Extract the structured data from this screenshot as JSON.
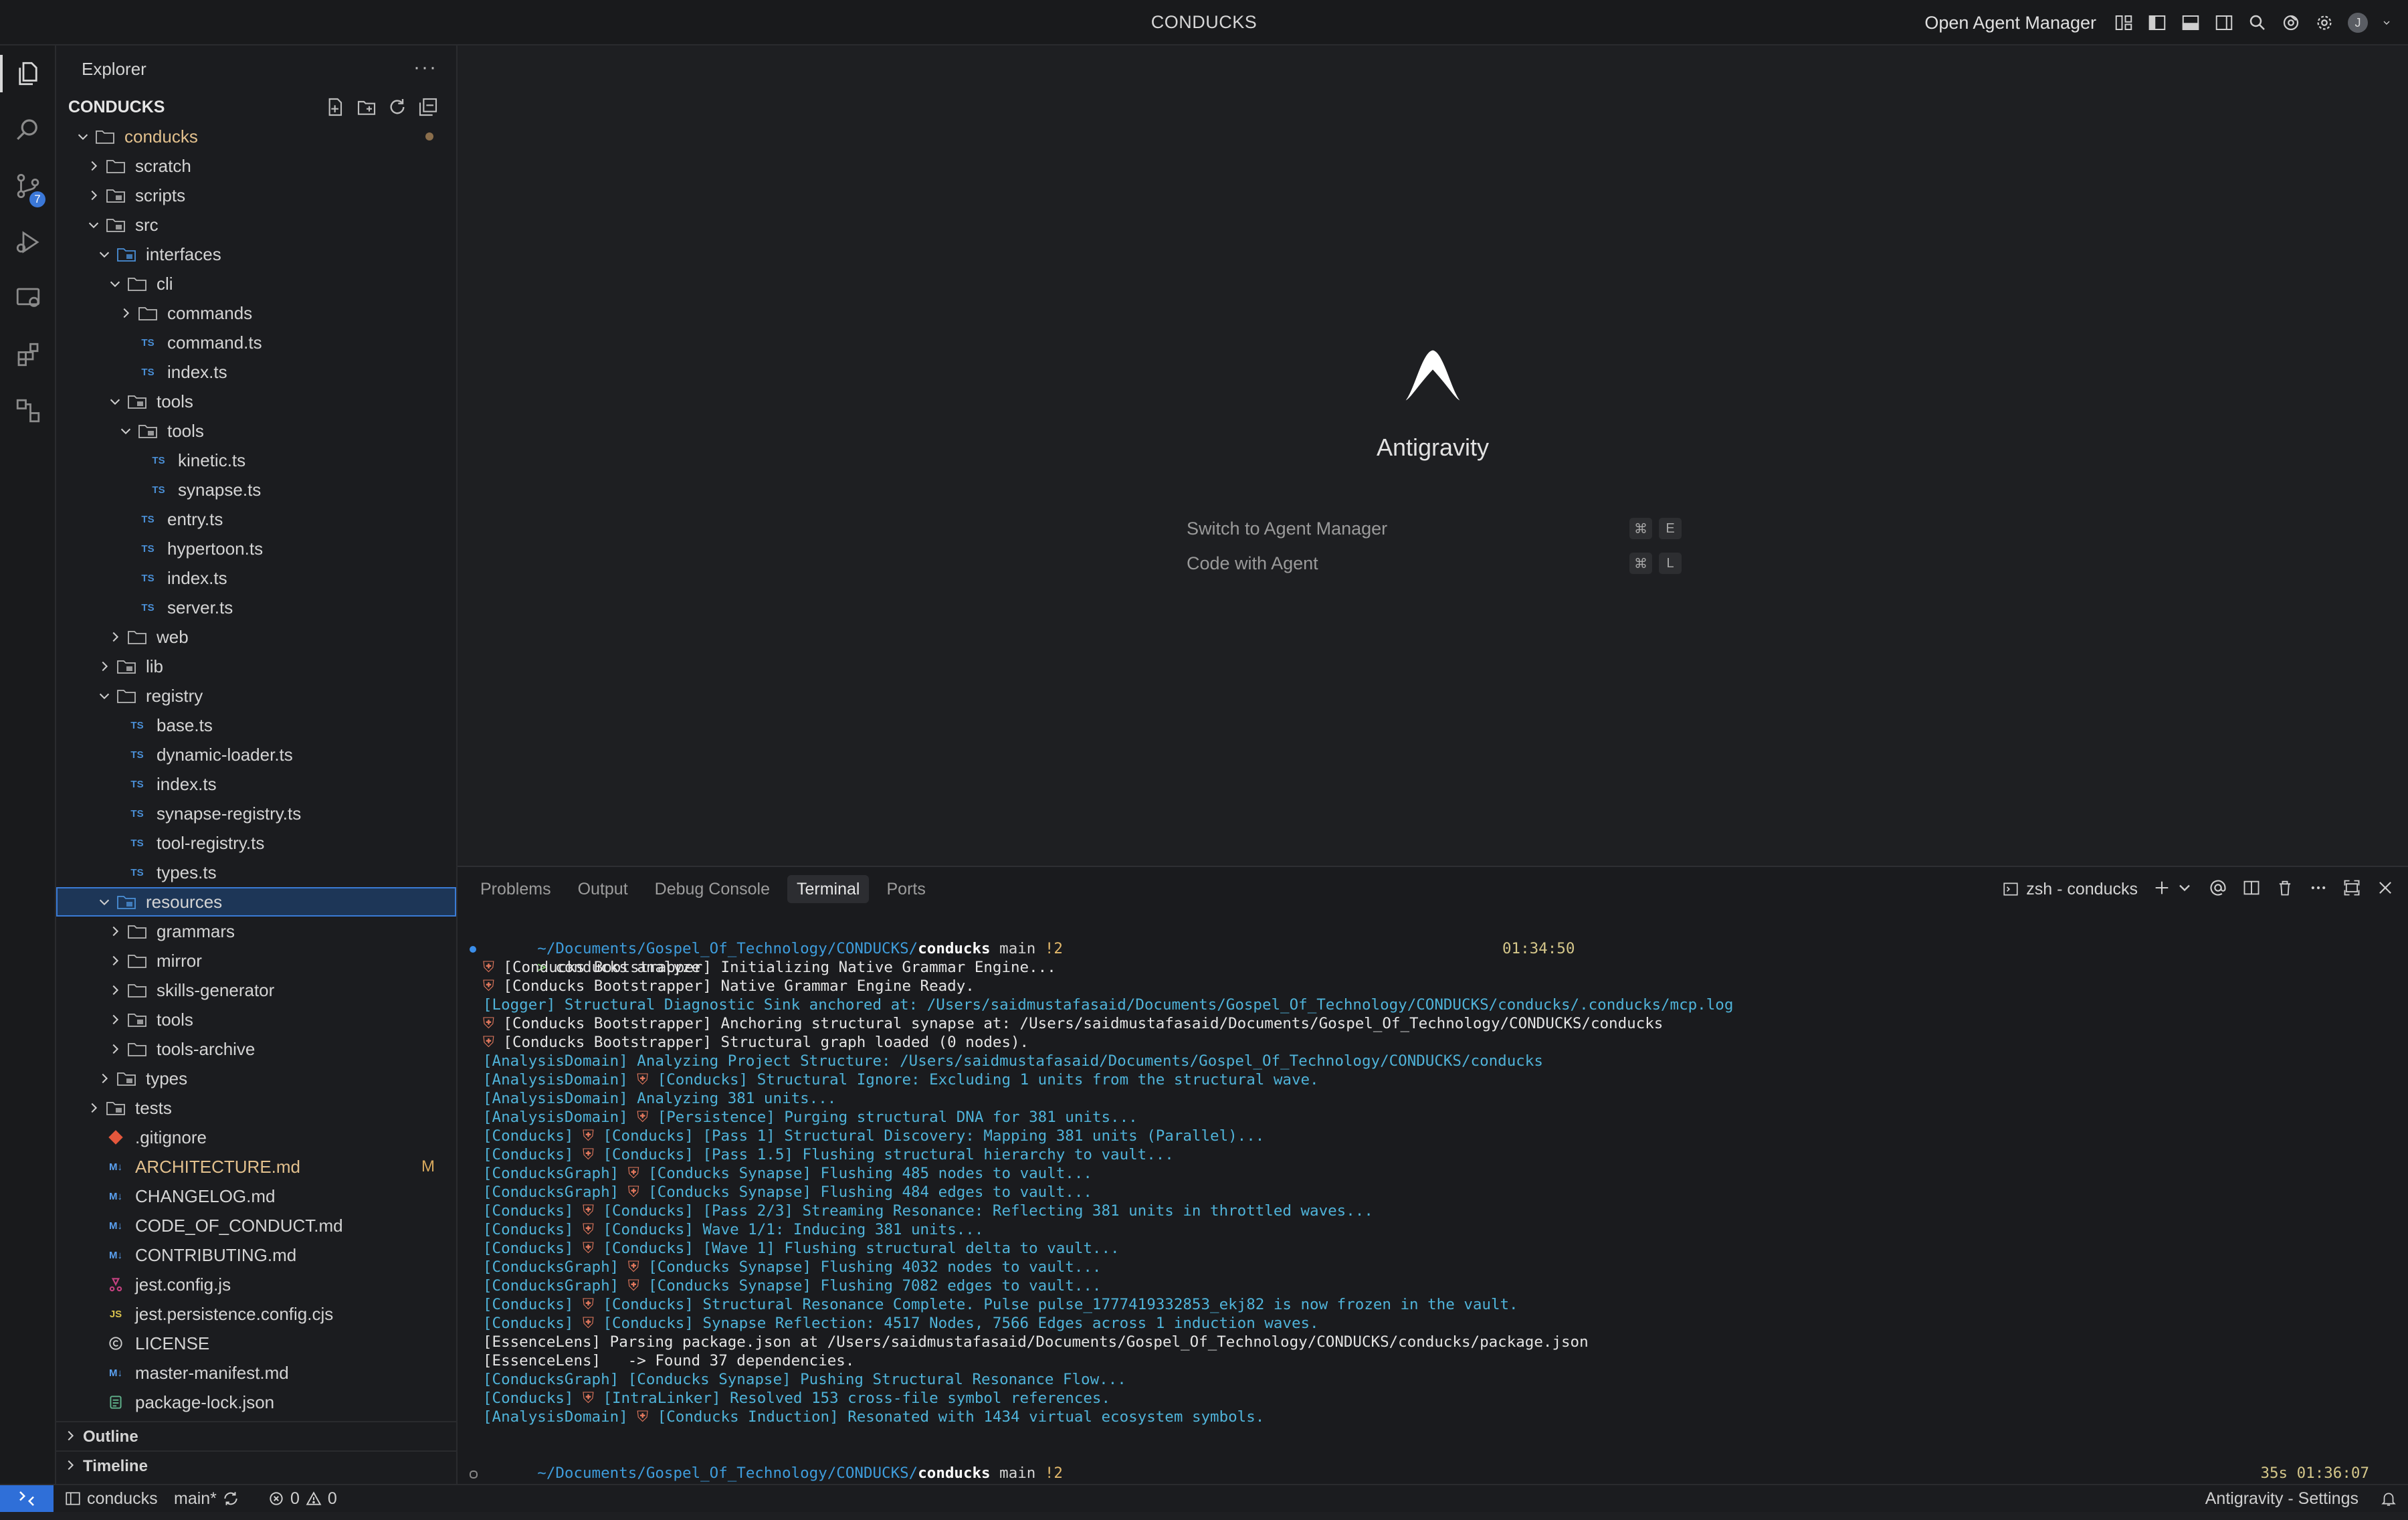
{
  "titlebar": {
    "title": "CONDUCKS",
    "agent_manager_label": "Open Agent Manager",
    "account_initial": "J"
  },
  "activity_bar": {
    "scm_badge": "7"
  },
  "sidebar": {
    "title": "Explorer",
    "more_label": "···",
    "root_label": "CONDUCKS",
    "tree": [
      {
        "label": "conducks",
        "depth": 0,
        "kind": "folder",
        "open": true,
        "gold": true,
        "dot": true
      },
      {
        "label": "scratch",
        "depth": 1,
        "kind": "folder",
        "open": false
      },
      {
        "label": "scripts",
        "depth": 1,
        "kind": "folder-special",
        "open": false
      },
      {
        "label": "src",
        "depth": 1,
        "kind": "folder-special",
        "open": true
      },
      {
        "label": "interfaces",
        "depth": 2,
        "kind": "folder-blue",
        "open": true
      },
      {
        "label": "cli",
        "depth": 3,
        "kind": "folder",
        "open": true
      },
      {
        "label": "commands",
        "depth": 4,
        "kind": "folder",
        "open": false
      },
      {
        "label": "command.ts",
        "depth": 4,
        "kind": "ts"
      },
      {
        "label": "index.ts",
        "depth": 4,
        "kind": "ts"
      },
      {
        "label": "tools",
        "depth": 3,
        "kind": "folder-special",
        "open": true
      },
      {
        "label": "tools",
        "depth": 4,
        "kind": "folder-special",
        "open": true
      },
      {
        "label": "kinetic.ts",
        "depth": 5,
        "kind": "ts"
      },
      {
        "label": "synapse.ts",
        "depth": 5,
        "kind": "ts"
      },
      {
        "label": "entry.ts",
        "depth": 4,
        "kind": "ts"
      },
      {
        "label": "hypertoon.ts",
        "depth": 4,
        "kind": "ts"
      },
      {
        "label": "index.ts",
        "depth": 4,
        "kind": "ts"
      },
      {
        "label": "server.ts",
        "depth": 4,
        "kind": "ts"
      },
      {
        "label": "web",
        "depth": 3,
        "kind": "folder",
        "open": false
      },
      {
        "label": "lib",
        "depth": 2,
        "kind": "folder-special",
        "open": false
      },
      {
        "label": "registry",
        "depth": 2,
        "kind": "folder",
        "open": true
      },
      {
        "label": "base.ts",
        "depth": 3,
        "kind": "ts"
      },
      {
        "label": "dynamic-loader.ts",
        "depth": 3,
        "kind": "ts"
      },
      {
        "label": "index.ts",
        "depth": 3,
        "kind": "ts"
      },
      {
        "label": "synapse-registry.ts",
        "depth": 3,
        "kind": "ts"
      },
      {
        "label": "tool-registry.ts",
        "depth": 3,
        "kind": "ts"
      },
      {
        "label": "types.ts",
        "depth": 3,
        "kind": "ts"
      },
      {
        "label": "resources",
        "depth": 2,
        "kind": "folder-blue",
        "open": true,
        "selected": true
      },
      {
        "label": "grammars",
        "depth": 3,
        "kind": "folder",
        "open": false
      },
      {
        "label": "mirror",
        "depth": 3,
        "kind": "folder",
        "open": false
      },
      {
        "label": "skills-generator",
        "depth": 3,
        "kind": "folder",
        "open": false
      },
      {
        "label": "tools",
        "depth": 3,
        "kind": "folder-special",
        "open": false
      },
      {
        "label": "tools-archive",
        "depth": 3,
        "kind": "folder",
        "open": false
      },
      {
        "label": "types",
        "depth": 2,
        "kind": "folder-special",
        "open": false
      },
      {
        "label": "tests",
        "depth": 1,
        "kind": "folder-special",
        "open": false
      },
      {
        "label": ".gitignore",
        "depth": 1,
        "kind": "git"
      },
      {
        "label": "ARCHITECTURE.md",
        "depth": 1,
        "kind": "md",
        "gold": true,
        "mod": "M"
      },
      {
        "label": "CHANGELOG.md",
        "depth": 1,
        "kind": "md"
      },
      {
        "label": "CODE_OF_CONDUCT.md",
        "depth": 1,
        "kind": "md"
      },
      {
        "label": "CONTRIBUTING.md",
        "depth": 1,
        "kind": "md"
      },
      {
        "label": "jest.config.js",
        "depth": 1,
        "kind": "jest"
      },
      {
        "label": "jest.persistence.config.cjs",
        "depth": 1,
        "kind": "js"
      },
      {
        "label": "LICENSE",
        "depth": 1,
        "kind": "license"
      },
      {
        "label": "master-manifest.md",
        "depth": 1,
        "kind": "md"
      },
      {
        "label": "package-lock.json",
        "depth": 1,
        "kind": "json"
      }
    ],
    "outline_label": "Outline",
    "timeline_label": "Timeline"
  },
  "editor": {
    "brand": "Antigravity",
    "shortcuts": [
      {
        "label": "Switch to Agent Manager",
        "keys": [
          "⌘",
          "E"
        ]
      },
      {
        "label": "Code with Agent",
        "keys": [
          "⌘",
          "L"
        ]
      }
    ]
  },
  "panel": {
    "tabs": [
      "Problems",
      "Output",
      "Debug Console",
      "Terminal",
      "Ports"
    ],
    "active_tab": "Terminal",
    "terminal_name": "zsh - conducks",
    "prompt1": {
      "path": "~/Documents/Gospel_Of_Technology/CONDUCKS/",
      "dir": "conducks",
      "branch": "main",
      "changes": "!2",
      "time": "01:34:50"
    },
    "command": "conducks analyze",
    "lines": [
      {
        "color": "white",
        "shield": true,
        "text": "[Conducks Bootstrapper] Initializing Native Grammar Engine..."
      },
      {
        "color": "white",
        "shield": true,
        "text": "[Conducks Bootstrapper] Native Grammar Engine Ready."
      },
      {
        "color": "cyan",
        "shield": false,
        "text": "[Logger] Structural Diagnostic Sink anchored at: /Users/saidmustafasaid/Documents/Gospel_Of_Technology/CONDUCKS/conducks/.conducks/mcp.log"
      },
      {
        "color": "white",
        "shield": true,
        "text": "[Conducks Bootstrapper] Anchoring structural synapse at: /Users/saidmustafasaid/Documents/Gospel_Of_Technology/CONDUCKS/conducks"
      },
      {
        "color": "white",
        "shield": true,
        "text": "[Conducks Bootstrapper] Structural graph loaded (0 nodes)."
      },
      {
        "color": "cyan",
        "shield": false,
        "text": "[AnalysisDomain] Analyzing Project Structure: /Users/saidmustafasaid/Documents/Gospel_Of_Technology/CONDUCKS/conducks"
      },
      {
        "color": "cyan",
        "shield": false,
        "prefix": "[AnalysisDomain] ",
        "text": "[Conducks] Structural Ignore: Excluding 1 units from the structural wave."
      },
      {
        "color": "cyan",
        "shield": false,
        "text": "[AnalysisDomain] Analyzing 381 units..."
      },
      {
        "color": "cyan",
        "shield": false,
        "prefix": "[AnalysisDomain] ",
        "text": "[Persistence] Purging structural DNA for 381 units..."
      },
      {
        "color": "cyan",
        "shield": false,
        "prefix": "[Conducks] ",
        "text": "[Conducks] [Pass 1] Structural Discovery: Mapping 381 units (Parallel)..."
      },
      {
        "color": "cyan",
        "shield": false,
        "prefix": "[Conducks] ",
        "text": "[Conducks] [Pass 1.5] Flushing structural hierarchy to vault..."
      },
      {
        "color": "cyan",
        "shield": false,
        "prefix": "[ConducksGraph] ",
        "text": "[Conducks Synapse] Flushing 485 nodes to vault..."
      },
      {
        "color": "cyan",
        "shield": false,
        "prefix": "[ConducksGraph] ",
        "text": "[Conducks Synapse] Flushing 484 edges to vault..."
      },
      {
        "color": "cyan",
        "shield": false,
        "prefix": "[Conducks] ",
        "text": "[Conducks] [Pass 2/3] Streaming Resonance: Reflecting 381 units in throttled waves..."
      },
      {
        "color": "cyan",
        "shield": false,
        "prefix": "[Conducks] ",
        "text": "[Conducks] Wave 1/1: Inducing 381 units..."
      },
      {
        "color": "cyan",
        "shield": false,
        "prefix": "[Conducks] ",
        "text": "[Conducks] [Wave 1] Flushing structural delta to vault..."
      },
      {
        "color": "cyan",
        "shield": false,
        "prefix": "[ConducksGraph] ",
        "text": "[Conducks Synapse] Flushing 4032 nodes to vault..."
      },
      {
        "color": "cyan",
        "shield": false,
        "prefix": "[ConducksGraph] ",
        "text": "[Conducks Synapse] Flushing 7082 edges to vault..."
      },
      {
        "color": "cyan",
        "shield": false,
        "prefix": "[Conducks] ",
        "text": "[Conducks] Structural Resonance Complete. Pulse pulse_1777419332853_ekj82 is now frozen in the vault."
      },
      {
        "color": "cyan",
        "shield": false,
        "prefix": "[Conducks] ",
        "text": "[Conducks] Synapse Reflection: 4517 Nodes, 7566 Edges across 1 induction waves."
      },
      {
        "color": "white",
        "shield": false,
        "text": "[EssenceLens] Parsing package.json at /Users/saidmustafasaid/Documents/Gospel_Of_Technology/CONDUCKS/conducks/package.json"
      },
      {
        "color": "white",
        "shield": false,
        "text": "[EssenceLens]   -> Found 37 dependencies."
      },
      {
        "color": "cyan",
        "shield": false,
        "text": "[ConducksGraph] [Conducks Synapse] Pushing Structural Resonance Flow..."
      },
      {
        "color": "cyan",
        "shield": false,
        "prefix": "[Conducks] ",
        "text": "[IntraLinker] Resolved 153 cross-file symbol references."
      },
      {
        "color": "cyan",
        "shield": false,
        "prefix": "[AnalysisDomain] ",
        "text": "[Conducks Induction] Resonated with 1434 virtual ecosystem symbols."
      }
    ],
    "prompt2": {
      "path": "~/Documents/Gospel_Of_Technology/CONDUCKS/",
      "dir": "conducks",
      "branch": "main",
      "changes": "!2",
      "elapsed": "35s",
      "time": "01:36:07"
    },
    "prompt_char": ">"
  },
  "statusbar": {
    "folder": "conducks",
    "branch": "main*",
    "errors": "0",
    "warnings": "0",
    "settings": "Antigravity - Settings"
  }
}
